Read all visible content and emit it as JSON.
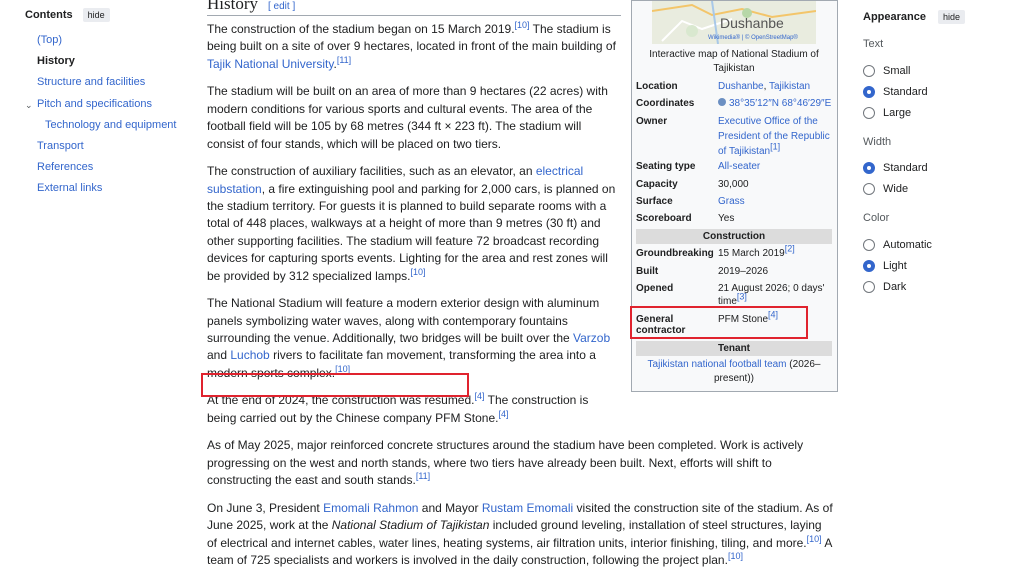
{
  "toc": {
    "title": "Contents",
    "hide": "hide",
    "items": [
      {
        "label": "(Top)"
      },
      {
        "label": "History"
      },
      {
        "label": "Structure and facilities"
      },
      {
        "label": "Pitch and specifications"
      },
      {
        "label": "Technology and equipment"
      },
      {
        "label": "Transport"
      },
      {
        "label": "References"
      },
      {
        "label": "External links"
      }
    ]
  },
  "heading": {
    "title": "History",
    "edit": "[ edit ]"
  },
  "article": {
    "p1": {
      "t1": "The construction of the stadium began on 15 March 2019.",
      "r1": "[10]",
      "t2": " The stadium is being built on a site of over 9 hectares, located in front of the main building of ",
      "link1": "Tajik National University",
      "t3": ".",
      "r2": "[11]"
    },
    "p2": {
      "t1": "The stadium will be built on an area of more than 9 hectares (22 acres) with modern conditions for various sports and cultural events. The area of the football field will be 105 by 68 metres (344 ft × 223 ft). The stadium will consist of four stands, which will be placed on two tiers."
    },
    "p3": {
      "t1": "The construction of auxiliary facilities, such as an elevator, an ",
      "link1": "electrical substation",
      "t2": ", a fire extinguishing pool and parking for 2,000 cars, is planned on the stadium territory. For guests it is planned to build separate rooms with a total of 448 places, walkways at a height of more than 9 metres (30 ft) and other supporting facilities. The stadium will feature 72 broadcast recording devices for capturing sports events. Lighting for the area and rest zones will be provided by 312 specialized lamps.",
      "r1": "[10]"
    },
    "p4": {
      "t1": "The National Stadium will feature a modern exterior design with aluminum panels symbolizing water waves, along with contemporary fountains surrounding the venue. Additionally, two bridges will be built over the ",
      "link1": "Varzob",
      "t2": " and ",
      "link2": "Luchob",
      "t3": " rivers to facilitate fan movement, transforming the area into a modern sports complex.",
      "r1": "[10]"
    },
    "p5": {
      "t1": "At the end of 2024, the construction was resumed.",
      "r1": "[4]",
      "t2": " The construction is being carried out by the Chinese company PFM Stone.",
      "r2": "[4]"
    },
    "p6": {
      "t1": "As of May 2025, major reinforced concrete structures around the stadium have been completed. Work is actively progressing on the west and north stands, where two tiers have already been built. Next, efforts will shift to constructing the east and south stands.",
      "r1": "[11]"
    },
    "p7": {
      "t1": "On June 3, President ",
      "link1": "Emomali Rahmon",
      "t2": " and Mayor ",
      "link2": "Rustam Emomali",
      "t3": " visited the construction site of the stadium. As of June 2025, work at the ",
      "em1": "National Stadium of Tajikistan",
      "t4": " included ground leveling, installation of steel structures, laying of electrical and internet cables, water lines, heating systems, air filtration units, interior finishing, tiling, and more.",
      "r1": "[10]",
      "t5": " A team of 725 specialists and workers is involved in the daily construction, following the project plan.",
      "r2": "[10]"
    }
  },
  "infobox": {
    "map_label": "Dushanbe",
    "map_credit": "Wikimedia® | © OpenStreetMap®",
    "map_caption": "Interactive map of National Stadium of Tajikistan",
    "location_label": "Location",
    "location_link1": "Dushanbe",
    "location_sep": ", ",
    "location_link2": "Tajikistan",
    "coordinates_label": "Coordinates",
    "coordinates_value": "38°35′12″N 68°46′29″E",
    "owner_label": "Owner",
    "owner_value": "Executive Office of the President of the Republic of Tajikistan",
    "owner_ref": "[1]",
    "seating_label": "Seating type",
    "seating_value": "All-seater",
    "capacity_label": "Capacity",
    "capacity_value": "30,000",
    "surface_label": "Surface",
    "surface_value": "Grass",
    "scoreboard_label": "Scoreboard",
    "scoreboard_value": "Yes",
    "construction_section": "Construction",
    "groundbreaking_label": "Groundbreaking",
    "groundbreaking_value": "15 March 2019",
    "groundbreaking_ref": "[2]",
    "built_label": "Built",
    "built_value": "2019–2026",
    "opened_label": "Opened",
    "opened_value": "21 August 2026; 0 days' time",
    "opened_ref": "[3]",
    "contractor_label": "General contractor",
    "contractor_value": "PFM Stone",
    "contractor_ref": "[4]",
    "tenant_section": "Tenant",
    "tenant_link": "Tajikistan national football team",
    "tenant_years": " (2026–present))"
  },
  "appearance": {
    "title": "Appearance",
    "hide": "hide",
    "text_label": "Text",
    "text_options": [
      "Small",
      "Standard",
      "Large"
    ],
    "width_label": "Width",
    "width_options": [
      "Standard",
      "Wide"
    ],
    "color_label": "Color",
    "color_options": [
      "Automatic",
      "Light",
      "Dark"
    ]
  },
  "colors": {
    "link": "#3366cc",
    "highlight": "#e0232e",
    "radio_on": "#3366cc"
  }
}
